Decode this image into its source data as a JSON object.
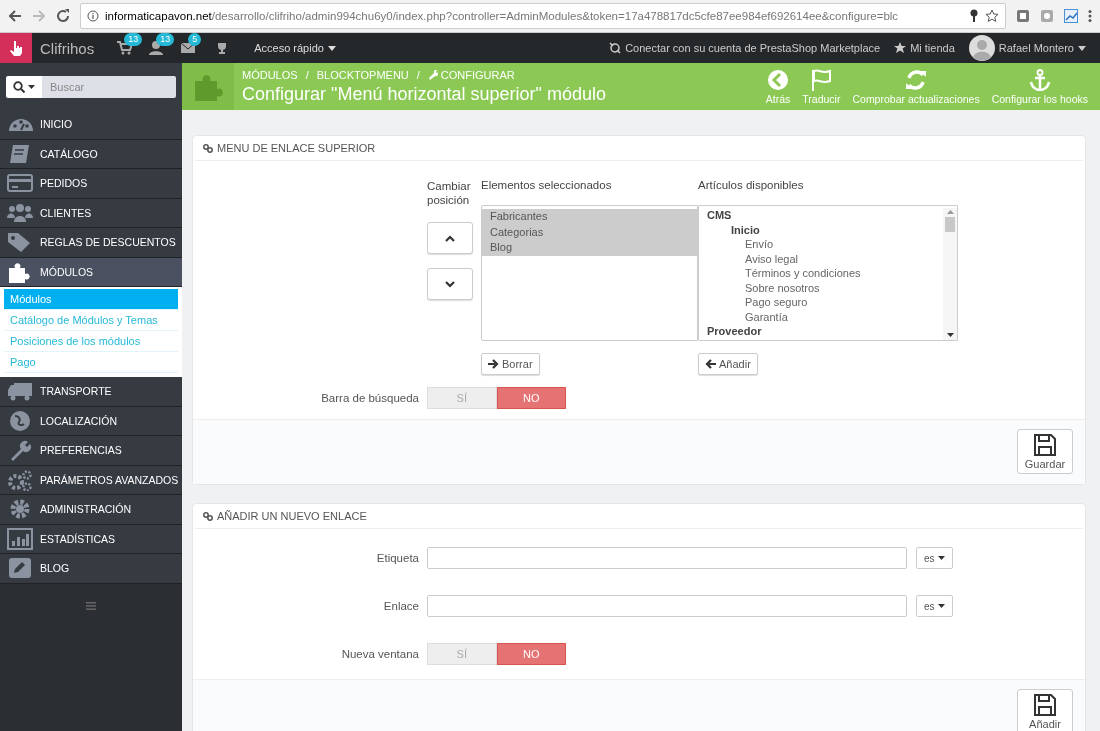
{
  "browser": {
    "url_host": "informaticapavon.net",
    "url_path": "/desarrollo/clifriho/admin994chu6y0/index.php?controller=AdminModules&token=17a478817dc5cfe87ee984ef692614ee&configure=blc"
  },
  "topbar": {
    "shop_name": "Clifrihos",
    "badges": [
      {
        "count": "13"
      },
      {
        "count": "13"
      },
      {
        "count": "5"
      }
    ],
    "quick_access": "Acceso rápido",
    "marketplace": "Conectar con su cuenta de PrestaShop Marketplace",
    "my_store": "Mi tienda",
    "user": "Rafael Montero"
  },
  "search": {
    "placeholder": "Buscar"
  },
  "sidebar": {
    "items": [
      {
        "label": "INICIO",
        "selected": false
      },
      {
        "label": "CATÁLOGO",
        "selected": false
      },
      {
        "label": "PEDIDOS",
        "selected": false
      },
      {
        "label": "CLIENTES",
        "selected": false
      },
      {
        "label": "REGLAS DE DESCUENTOS",
        "selected": false
      },
      {
        "label": "MÓDULOS",
        "selected": true,
        "children": [
          {
            "label": "Módulos",
            "selected": true
          },
          {
            "label": "Catálogo de Módulos y Temas",
            "selected": false
          },
          {
            "label": "Posiciones de los módulos",
            "selected": false
          },
          {
            "label": "Pago",
            "selected": false
          }
        ]
      },
      {
        "label": "TRANSPORTE",
        "selected": false
      },
      {
        "label": "LOCALIZACIÓN",
        "selected": false
      },
      {
        "label": "PREFERENCIAS",
        "selected": false
      },
      {
        "label": "PARÁMETROS AVANZADOS",
        "selected": false
      },
      {
        "label": "ADMINISTRACIÓN",
        "selected": false
      },
      {
        "label": "ESTADÍSTICAS",
        "selected": false
      },
      {
        "label": "BLOG",
        "selected": false
      }
    ]
  },
  "page_header": {
    "breadcrumb": [
      {
        "label": "MÓDULOS",
        "separator": "/"
      },
      {
        "label": "BLOCKTOPMENU",
        "separator": "/"
      },
      {
        "label": "CONFIGURAR"
      }
    ],
    "title": "Configurar \"Menú horizontal superior\" módulo",
    "toolbar": [
      {
        "label": "Atrás"
      },
      {
        "label": "Traducir"
      },
      {
        "label": "Comprobar actualizaciones"
      },
      {
        "label": "Configurar los hooks"
      }
    ]
  },
  "top_menu_panel": {
    "title": "MENU DE ENLACE SUPERIOR",
    "position_label": "Cambiar posición",
    "selected_label": "Elementos seleccionados",
    "selected_items": [
      {
        "label": "Fabricantes",
        "selected": true
      },
      {
        "label": "Categorias",
        "selected": true
      },
      {
        "label": "Blog",
        "selected": true
      }
    ],
    "available_label": "Artículos disponibles",
    "available_items": [
      {
        "label": "CMS",
        "children": [
          {
            "label": "Inicio",
            "children": [
              {
                "label": "Envío"
              },
              {
                "label": "Aviso legal"
              },
              {
                "label": "Términos y condiciones"
              },
              {
                "label": "Sobre nosotros"
              },
              {
                "label": "Pago seguro"
              },
              {
                "label": "Garantía"
              }
            ]
          }
        ]
      },
      {
        "label": "Proveedor"
      }
    ],
    "remove_button": "Borrar",
    "add_button": "Añadir",
    "search_bar": {
      "label": "Barra de búsqueda",
      "options": [
        {
          "label": "SÍ",
          "selected": false
        },
        {
          "label": "NO",
          "selected": true
        }
      ]
    },
    "save_button": "Guardar"
  },
  "new_link_panel": {
    "title": "AÑADIR UN NUEVO ENLACE",
    "fields": [
      {
        "label": "Etiqueta",
        "language": "es"
      },
      {
        "label": "Enlace",
        "language": "es"
      }
    ],
    "new_window": {
      "label": "Nueva ventana",
      "options": [
        {
          "label": "SÍ",
          "selected": false
        },
        {
          "label": "NO",
          "selected": true
        }
      ]
    },
    "save_button": "Añadir"
  }
}
